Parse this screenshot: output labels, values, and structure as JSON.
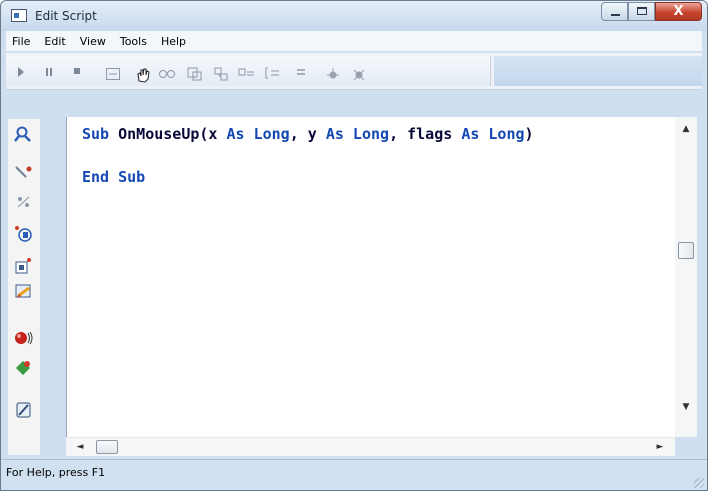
{
  "window": {
    "title": "Edit Script",
    "close_glyph": "X"
  },
  "menubar": {
    "items": [
      "File",
      "Edit",
      "View",
      "Tools",
      "Help"
    ]
  },
  "toolbar": {
    "buttons": [
      "play-icon",
      "pause-icon",
      "stop-icon",
      "breakpoint-icon",
      "hand-icon",
      "watch-icon",
      "step-into-icon",
      "step-over-icon",
      "step-out-icon",
      "bracket-icon",
      "equals-icon",
      "add-bug-icon",
      "remove-bug-icon"
    ]
  },
  "gutter": {
    "icons": [
      "find-icon",
      "search-replace-icon",
      "percent-icon",
      "object-browser-icon",
      "properties-icon",
      "edit-icon",
      "record-icon",
      "insert-icon",
      "script-icon"
    ]
  },
  "editor": {
    "line1": {
      "kw1": "Sub",
      "text1": " OnMouseUp(x ",
      "kw2": "As Long",
      "text2": ", y ",
      "kw3": "As Long",
      "text3": ", flags ",
      "kw4": "As Long",
      "text4": ")"
    },
    "line2": {
      "kw": "End Sub"
    }
  },
  "scroll": {
    "up": "▲",
    "down": "▼",
    "left": "◄",
    "right": "►"
  },
  "status": {
    "text": "For Help, press F1"
  }
}
